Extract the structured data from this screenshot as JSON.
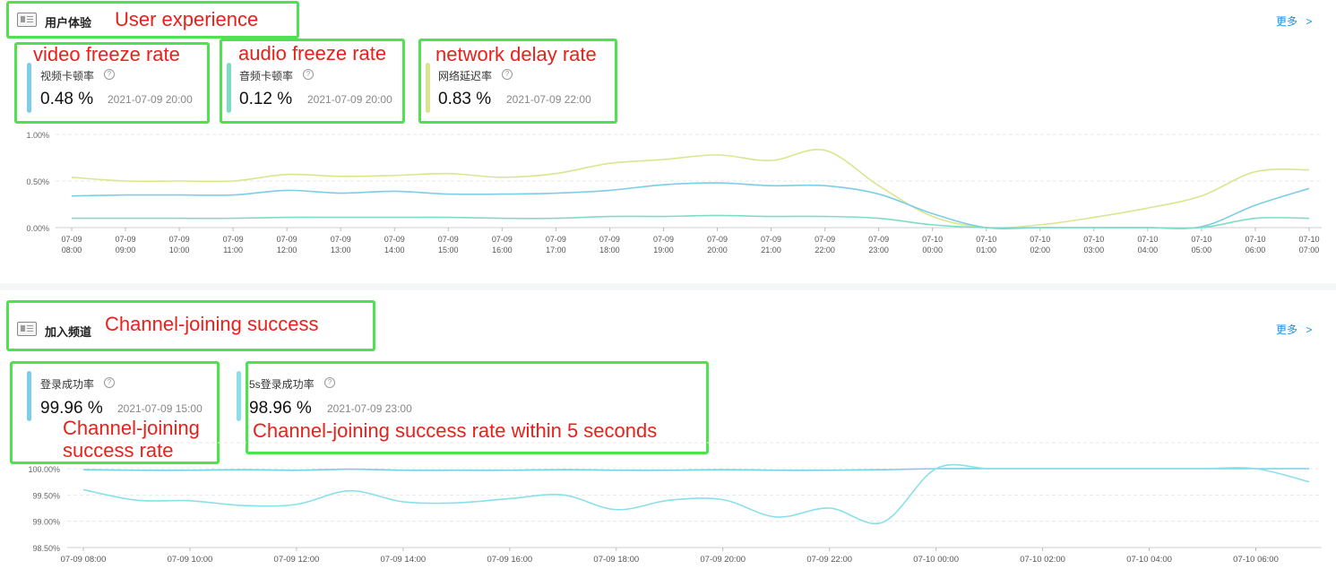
{
  "sections": [
    {
      "title": "用户体验",
      "annotation": "User experience",
      "more": "更多",
      "metrics": [
        {
          "name": "视频卡顿率",
          "value": "0.48 %",
          "time": "2021-07-09 20:00",
          "annotation": "video freeze rate",
          "color": "#7ccde8"
        },
        {
          "name": "音频卡顿率",
          "value": "0.12 %",
          "time": "2021-07-09 20:00",
          "annotation": "audio freeze rate",
          "color": "#7fdcc4"
        },
        {
          "name": "网络延迟率",
          "value": "0.83 %",
          "time": "2021-07-09 22:00",
          "annotation": "network delay rate",
          "color": "#dbe58f"
        }
      ]
    },
    {
      "title": "加入频道",
      "annotation": "Channel-joining success",
      "more": "更多",
      "metrics": [
        {
          "name": "登录成功率",
          "value": "99.96 %",
          "time": "2021-07-09 15:00",
          "annotation": "Channel-joining success rate",
          "color": "#7ccde8"
        },
        {
          "name": "5s登录成功率",
          "value": "98.96 %",
          "time": "2021-07-09 23:00",
          "annotation": "Channel-joining success rate within 5 seconds",
          "color": "#88e0ea"
        }
      ]
    }
  ],
  "chart_data": [
    {
      "type": "line",
      "ylim": [
        0,
        1.0
      ],
      "y_ticks": [
        "0.00%",
        "0.50%",
        "1.00%"
      ],
      "x": [
        "07-09 08:00",
        "07-09 09:00",
        "07-09 10:00",
        "07-09 11:00",
        "07-09 12:00",
        "07-09 13:00",
        "07-09 14:00",
        "07-09 15:00",
        "07-09 16:00",
        "07-09 17:00",
        "07-09 18:00",
        "07-09 19:00",
        "07-09 20:00",
        "07-09 21:00",
        "07-09 22:00",
        "07-09 23:00",
        "07-10 00:00",
        "07-10 01:00",
        "07-10 02:00",
        "07-10 03:00",
        "07-10 04:00",
        "07-10 05:00",
        "07-10 06:00",
        "07-10 07:00"
      ],
      "series": [
        {
          "color": "#dbe58f",
          "values": [
            0.54,
            0.5,
            0.5,
            0.5,
            0.57,
            0.55,
            0.56,
            0.58,
            0.54,
            0.58,
            0.69,
            0.73,
            0.78,
            0.72,
            0.83,
            0.45,
            0.12,
            0.0,
            0.03,
            0.11,
            0.21,
            0.34,
            0.6,
            0.62
          ]
        },
        {
          "color": "#7ccde8",
          "values": [
            0.34,
            0.35,
            0.35,
            0.35,
            0.4,
            0.37,
            0.39,
            0.36,
            0.36,
            0.37,
            0.4,
            0.46,
            0.48,
            0.45,
            0.45,
            0.36,
            0.15,
            0.0,
            0.0,
            0.0,
            0.0,
            0.01,
            0.24,
            0.42
          ]
        },
        {
          "color": "#7fdcc4",
          "values": [
            0.1,
            0.1,
            0.1,
            0.1,
            0.11,
            0.11,
            0.11,
            0.11,
            0.1,
            0.1,
            0.12,
            0.12,
            0.13,
            0.12,
            0.12,
            0.1,
            0.03,
            0.0,
            0.0,
            0.0,
            0.0,
            0.0,
            0.1,
            0.1
          ]
        }
      ]
    },
    {
      "type": "line",
      "ylim": [
        98.5,
        100.0
      ],
      "y_ticks": [
        "98.50%",
        "99.00%",
        "99.50%",
        "100.00%"
      ],
      "x_ticks": [
        "07-09 08:00",
        "07-09 10:00",
        "07-09 12:00",
        "07-09 14:00",
        "07-09 16:00",
        "07-09 18:00",
        "07-09 20:00",
        "07-09 22:00",
        "07-10 00:00",
        "07-10 02:00",
        "07-10 04:00",
        "07-10 06:00"
      ],
      "series": [
        {
          "color": "#7ccde8",
          "values": [
            99.98,
            99.97,
            99.97,
            99.98,
            99.97,
            99.99,
            99.97,
            99.97,
            99.97,
            99.98,
            99.97,
            99.97,
            99.98,
            99.97,
            99.97,
            99.98,
            100.0,
            100.0,
            100.0,
            100.0,
            100.0,
            100.0,
            100.0,
            100.0
          ]
        },
        {
          "color": "#88e0ea",
          "values": [
            99.6,
            99.4,
            99.39,
            99.3,
            99.32,
            99.58,
            99.37,
            99.35,
            99.43,
            99.5,
            99.22,
            99.4,
            99.41,
            99.08,
            99.25,
            98.98,
            100.0,
            100.0,
            100.0,
            100.0,
            100.0,
            100.0,
            100.0,
            99.75
          ]
        }
      ]
    }
  ]
}
